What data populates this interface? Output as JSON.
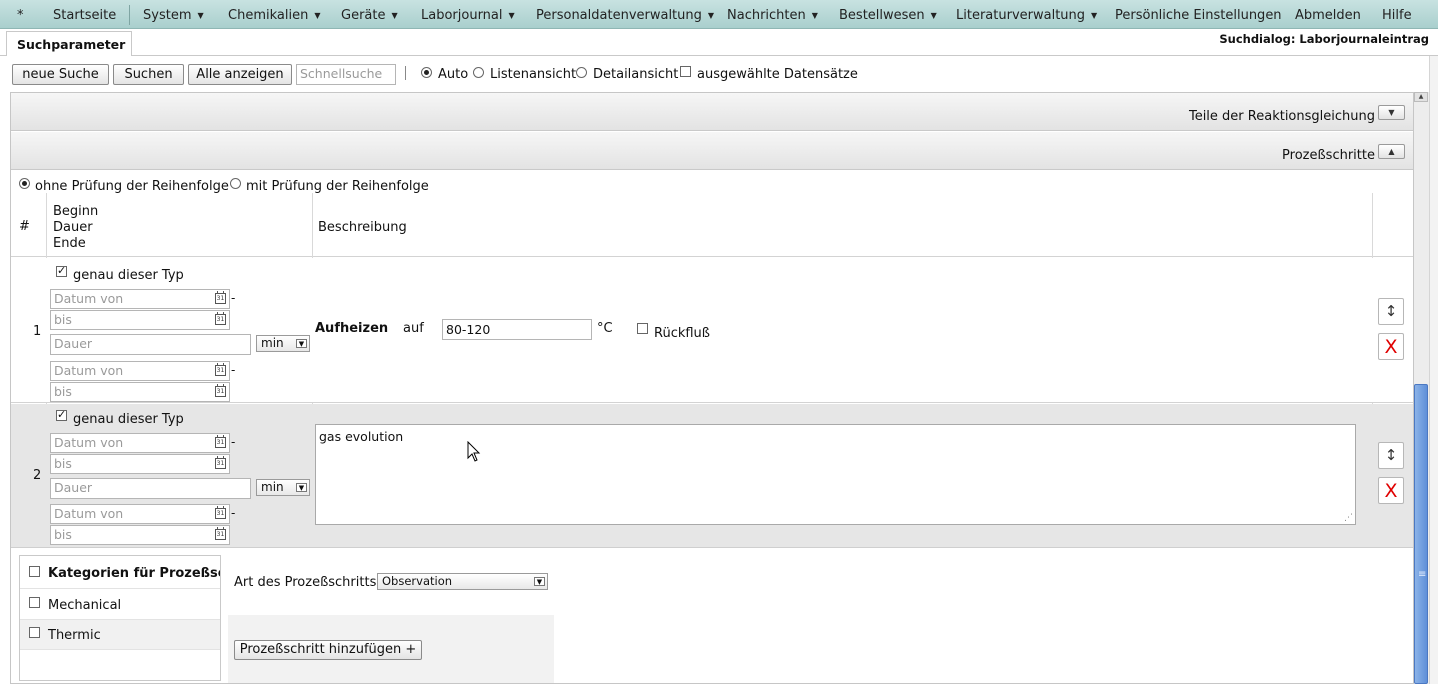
{
  "menu": {
    "items": [
      {
        "label": "*",
        "dropdown": false
      },
      {
        "label": "Startseite",
        "dropdown": false
      },
      {
        "label": "System",
        "dropdown": true
      },
      {
        "label": "Chemikalien",
        "dropdown": true
      },
      {
        "label": "Geräte",
        "dropdown": true
      },
      {
        "label": "Laborjournal",
        "dropdown": true
      },
      {
        "label": "Personaldatenverwaltung",
        "dropdown": true
      },
      {
        "label": "Nachrichten",
        "dropdown": true
      },
      {
        "label": "Bestellwesen",
        "dropdown": true
      },
      {
        "label": "Literaturverwaltung",
        "dropdown": true
      },
      {
        "label": "Persönliche Einstellungen",
        "dropdown": false
      },
      {
        "label": "Abmelden",
        "dropdown": false
      },
      {
        "label": "Hilfe",
        "dropdown": false
      }
    ]
  },
  "tab": {
    "label": "Suchparameter"
  },
  "dialog_title": "Suchdialog: Laborjournaleintrag",
  "toolbar": {
    "new_search": "neue Suche",
    "search": "Suchen",
    "show_all": "Alle anzeigen",
    "quicksearch_placeholder": "Schnellsuche",
    "view_auto": "Auto",
    "view_list": "Listenansicht",
    "view_detail": "Detailansicht",
    "selected_records": "ausgewählte Datensätze",
    "selected_view": "auto"
  },
  "sections": {
    "reaction_parts": "Teile der Reaktionsgleichung",
    "process_steps": "Prozeßschritte"
  },
  "order": {
    "without_check": "ohne Prüfung der Reihenfolge",
    "with_check": "mit Prüfung der Reihenfolge",
    "selected": "without"
  },
  "table": {
    "col_num": "#",
    "col_begin": "Beginn",
    "col_duration": "Dauer",
    "col_end": "Ende",
    "col_description": "Beschreibung"
  },
  "steps": [
    {
      "num": "1",
      "exact_type": "genau dieser Typ",
      "date_from_placeholder": "Datum von",
      "date_to_placeholder": "bis",
      "duration_placeholder": "Dauer",
      "duration_unit": "min",
      "calendar_day": "31",
      "dash": "-",
      "action": "Aufheizen",
      "on": "auf",
      "temperature": "80-120",
      "unit": "°C",
      "reflux": "Rückfluß"
    },
    {
      "num": "2",
      "exact_type": "genau dieser Typ",
      "date_from_placeholder": "Datum von",
      "date_to_placeholder": "bis",
      "duration_placeholder": "Dauer",
      "duration_unit": "min",
      "calendar_day": "31",
      "dash": "-",
      "description": "gas evolution"
    }
  ],
  "row_actions": {
    "move_icon": "↕",
    "delete_icon": "X"
  },
  "categories": {
    "header": "Kategorien für Prozeßschritte",
    "items": [
      "Mechanical",
      "Thermic"
    ]
  },
  "step_type": {
    "label": "Art des Prozeßschritts",
    "value": "Observation"
  },
  "add_step": "Prozeßschritt hinzufügen +",
  "scrollbar": {
    "grip": "≡"
  },
  "colors": {
    "menubar": "#b5d8d6",
    "delete": "#e00000",
    "scroll_thumb": "#6f9be0"
  }
}
